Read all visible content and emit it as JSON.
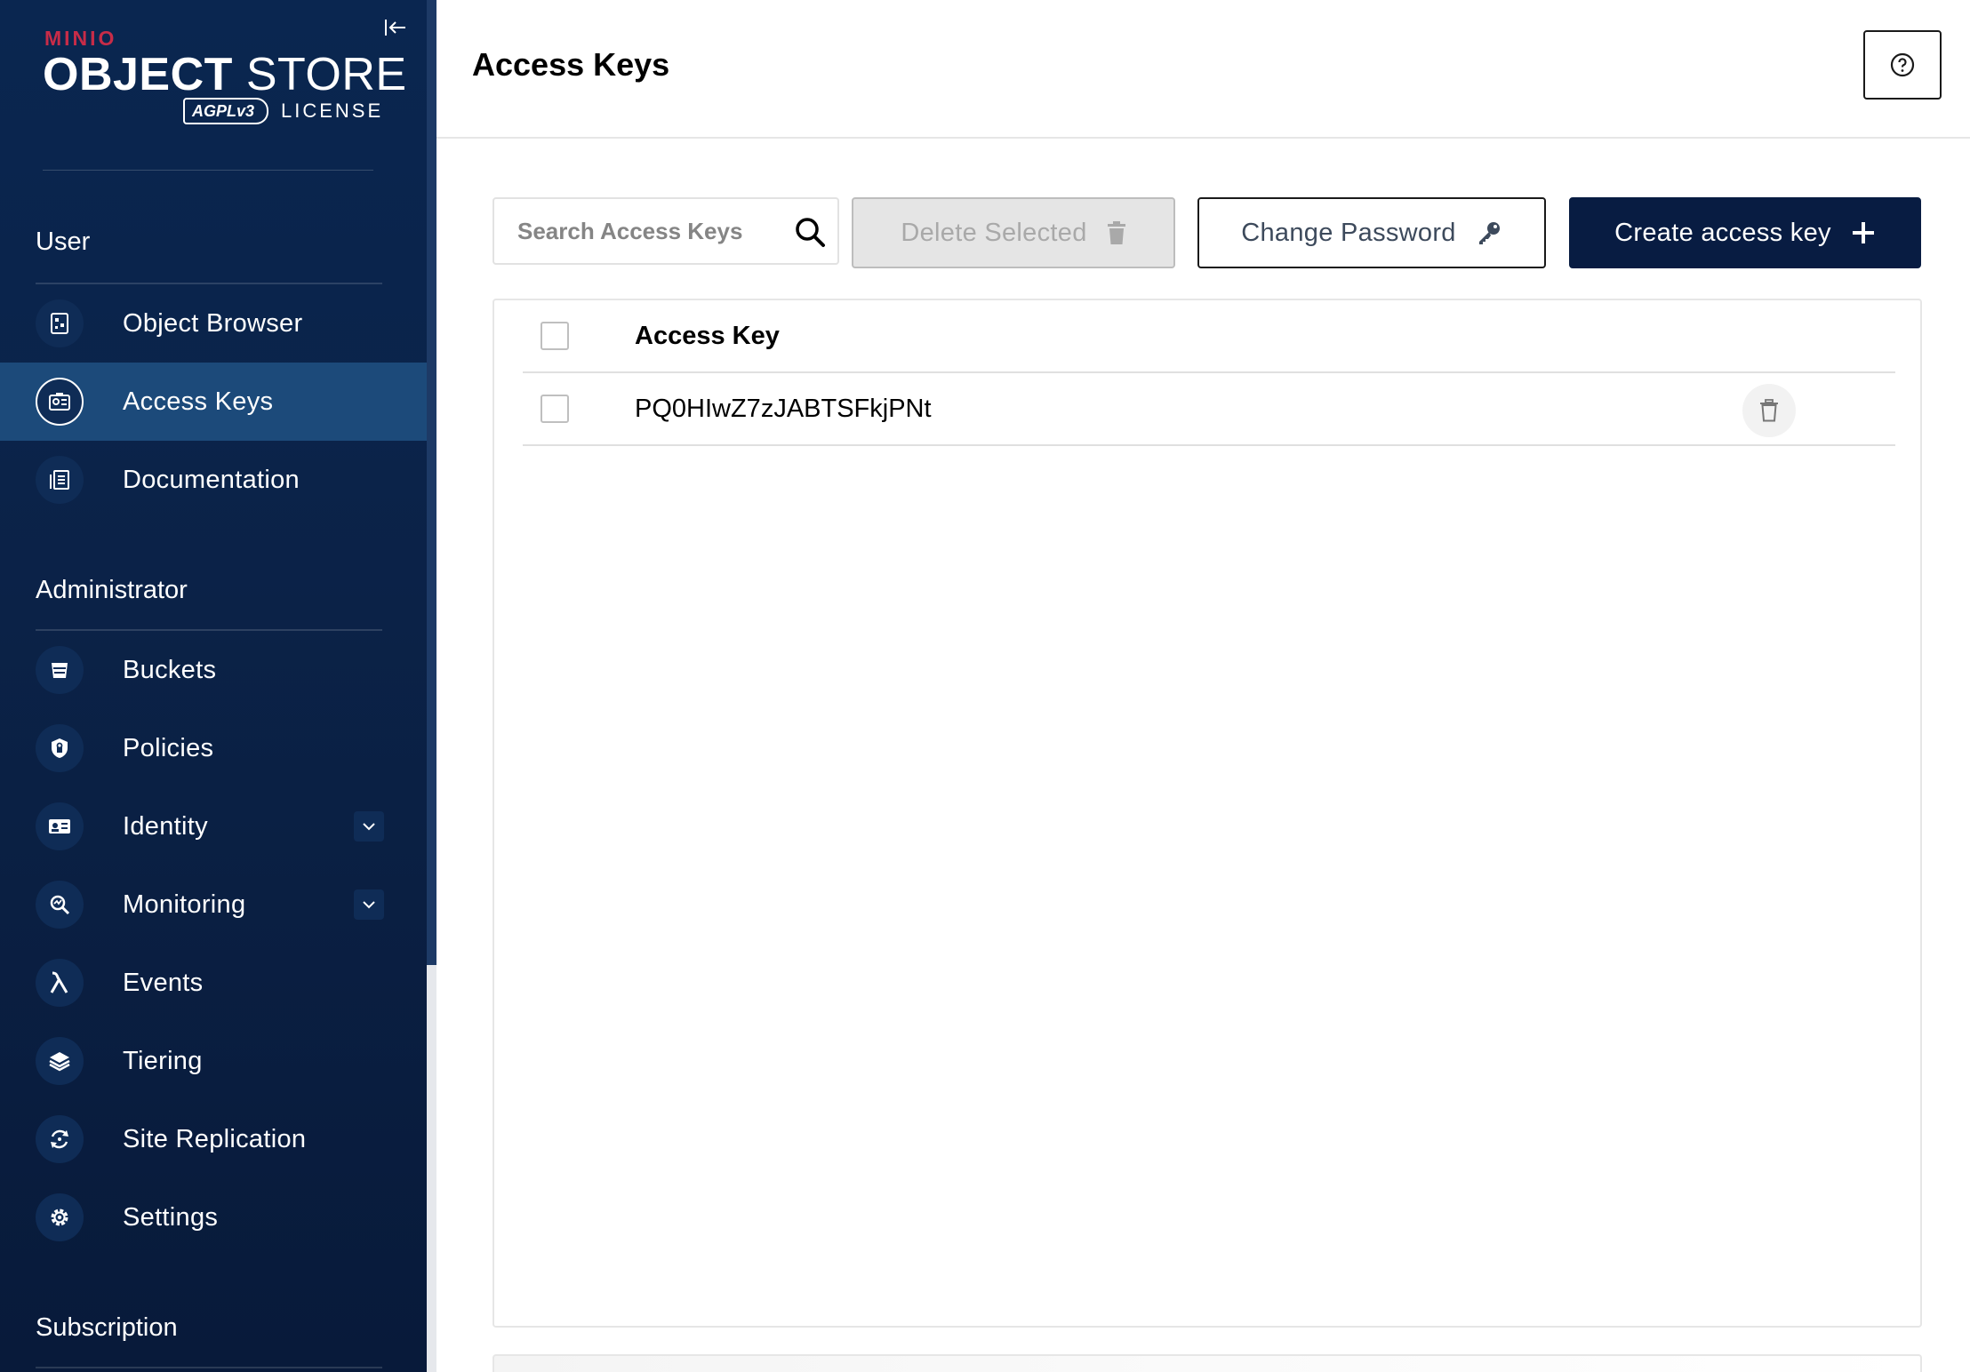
{
  "brand": {
    "vendor": "MINIO",
    "product_bold": "OBJECT",
    "product_light": "STORE",
    "license_badge": "AGPLv3",
    "license_label": "LICENSE"
  },
  "sidebar": {
    "sections": [
      {
        "title": "User",
        "items": [
          {
            "label": "Object Browser",
            "icon": "object-browser-icon",
            "active": false
          },
          {
            "label": "Access Keys",
            "icon": "access-keys-icon",
            "active": true
          },
          {
            "label": "Documentation",
            "icon": "documentation-icon",
            "active": false
          }
        ]
      },
      {
        "title": "Administrator",
        "items": [
          {
            "label": "Buckets",
            "icon": "bucket-icon"
          },
          {
            "label": "Policies",
            "icon": "policy-shield-icon"
          },
          {
            "label": "Identity",
            "icon": "identity-card-icon",
            "expandable": true
          },
          {
            "label": "Monitoring",
            "icon": "monitoring-icon",
            "expandable": true
          },
          {
            "label": "Events",
            "icon": "lambda-icon"
          },
          {
            "label": "Tiering",
            "icon": "tiering-layers-icon"
          },
          {
            "label": "Site Replication",
            "icon": "replication-icon"
          },
          {
            "label": "Settings",
            "icon": "gear-icon"
          }
        ]
      },
      {
        "title": "Subscription",
        "items": []
      }
    ]
  },
  "header": {
    "title": "Access Keys"
  },
  "toolbar": {
    "search_placeholder": "Search Access Keys",
    "delete_selected_label": "Delete Selected",
    "change_password_label": "Change Password",
    "create_key_label": "Create access key"
  },
  "table": {
    "columns": [
      "Access Key"
    ],
    "rows": [
      {
        "access_key": "PQ0HIwZ7zJABTSFkjPNt"
      }
    ]
  },
  "colors": {
    "sidebar_bg": "#0b2247",
    "sidebar_active": "#1c4a7a",
    "primary_button": "#081c42",
    "brand_red": "#c72c48"
  }
}
